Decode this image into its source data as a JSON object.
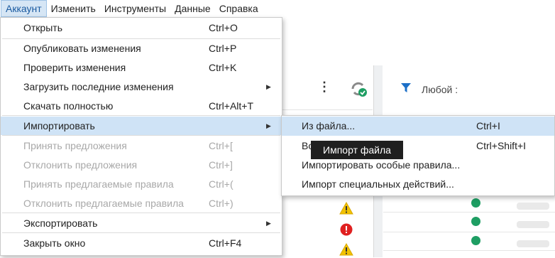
{
  "menubar": {
    "items": [
      {
        "label": "Аккаунт"
      },
      {
        "label": "Изменить"
      },
      {
        "label": "Инструменты"
      },
      {
        "label": "Данные"
      },
      {
        "label": "Справка"
      }
    ]
  },
  "background": {
    "filter_label": "Любой :"
  },
  "menu": {
    "items": [
      {
        "label": "Открыть",
        "shortcut": "Ctrl+O",
        "enabled": true
      },
      {
        "label": "Опубликовать изменения",
        "shortcut": "Ctrl+P",
        "enabled": true
      },
      {
        "label": "Проверить изменения",
        "shortcut": "Ctrl+K",
        "enabled": true
      },
      {
        "label": "Загрузить последние изменения",
        "shortcut": "",
        "enabled": true,
        "submenu": true
      },
      {
        "label": "Скачать полностью",
        "shortcut": "Ctrl+Alt+T",
        "enabled": true
      },
      {
        "label": "Импортировать",
        "shortcut": "",
        "enabled": true,
        "submenu": true,
        "highlighted": true
      },
      {
        "label": "Принять предложения",
        "shortcut": "Ctrl+[",
        "enabled": false
      },
      {
        "label": "Отклонить предложения",
        "shortcut": "Ctrl+]",
        "enabled": false
      },
      {
        "label": "Принять предлагаемые правила",
        "shortcut": "Ctrl+(",
        "enabled": false
      },
      {
        "label": "Отклонить предлагаемые правила",
        "shortcut": "Ctrl+)",
        "enabled": false
      },
      {
        "label": "Экспортировать",
        "shortcut": "",
        "enabled": true,
        "submenu": true
      },
      {
        "label": "Закрыть окно",
        "shortcut": "Ctrl+F4",
        "enabled": true
      }
    ]
  },
  "submenu": {
    "items": [
      {
        "label": "Из файла...",
        "shortcut": "Ctrl+I",
        "highlighted": true
      },
      {
        "label": "Во",
        "shortcut": "Ctrl+Shift+I"
      },
      {
        "label": "Импортировать особые правила...",
        "shortcut": ""
      },
      {
        "label": "Импорт специальных действий...",
        "shortcut": ""
      }
    ]
  },
  "tooltip": {
    "text": "Импорт файла"
  }
}
